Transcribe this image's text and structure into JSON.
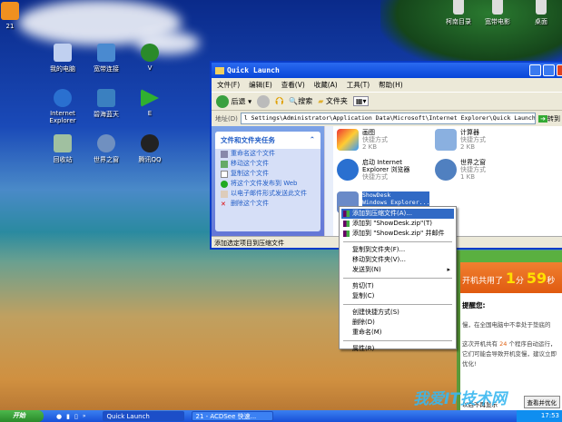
{
  "desktop": {
    "icons": [
      {
        "label": "21",
        "color": "#f09020"
      },
      {
        "label": "我的电脑",
        "color": "#c0d0f0"
      },
      {
        "label": "宽带连接",
        "color": "#4a8ad0"
      },
      {
        "label": "V",
        "color": "#2a8a2a"
      },
      {
        "label": "Internet Explorer",
        "color": "#2a70d0"
      },
      {
        "label": "碧海蓝天",
        "color": "#3a80c0"
      },
      {
        "label": "E",
        "color": "#30b030"
      },
      {
        "label": "回收站",
        "color": "#a0c0a0"
      },
      {
        "label": "世界之窗",
        "color": "#7090c0"
      },
      {
        "label": "腾讯QQ",
        "color": "#222"
      },
      {
        "label": "柯南目录",
        "color": "#ddd"
      },
      {
        "label": "宽带电影",
        "color": "#ddd"
      },
      {
        "label": "桌面",
        "color": "#ddd"
      }
    ]
  },
  "window": {
    "title": "Quick Launch",
    "menu": [
      "文件(F)",
      "编辑(E)",
      "查看(V)",
      "收藏(A)",
      "工具(T)",
      "帮助(H)"
    ],
    "toolbar": {
      "back": "后退",
      "search": "搜索",
      "folders": "文件夹"
    },
    "address_label": "地址(D)",
    "address": "l Settings\\Administrator\\Application Data\\Microsoft\\Internet Explorer\\Quick Launch",
    "go": "转到",
    "tasks_title": "文件和文件夹任务",
    "tasks": [
      "重命名这个文件",
      "移动这个文件",
      "复制这个文件",
      "将这个文件发布到 Web",
      "以电子邮件形式发送此文件",
      "删除这个文件"
    ],
    "files": [
      {
        "name": "画图",
        "type": "快捷方式",
        "size": "2 KB"
      },
      {
        "name": "计算器",
        "type": "快捷方式",
        "size": "2 KB"
      },
      {
        "name": "启动 Internet Explorer 浏览器",
        "type": "快捷方式",
        "size": ""
      },
      {
        "name": "世界之窗",
        "type": "快捷方式",
        "size": "1 KB"
      },
      {
        "name": "ShowDesk",
        "type": "Windows Explorer...",
        "size": ""
      }
    ],
    "status": "添加选定项目到压缩文件"
  },
  "context_menu": [
    [
      "添加到压缩文件(A)...",
      "添加到 \"ShowDesk.zip\"(T)",
      "添加到 \"ShowDesk.zip\" 并邮件"
    ],
    [
      "复制到文件夹(F)...",
      "移动到文件夹(V)...",
      "发送到(N)"
    ],
    [
      "剪切(T)",
      "复制(C)"
    ],
    [
      "创建快捷方式(S)",
      "删除(D)",
      "重命名(M)"
    ],
    [
      "属性(R)"
    ]
  ],
  "popup": {
    "header_prefix": "开机共用了",
    "minutes": "1",
    "min_unit": "分",
    "seconds": "59",
    "sec_unit": "秒",
    "remind": "提醒您:",
    "line1": "慢，在全国电脑中不幸处于垫底的",
    "line2_a": "这次开机共有",
    "count": "24",
    "line2_b": "个程序自动运行，它们可能会导致开机变慢，建议立即优化!",
    "dont_show": "以后不再显示",
    "optimize": "查看并优化"
  },
  "taskbar": {
    "start": "开始",
    "tasks": [
      "Quick Launch",
      "21 - ACDSee 快速..."
    ],
    "clock": "17:53"
  },
  "watermark": "我爱IT技术网"
}
